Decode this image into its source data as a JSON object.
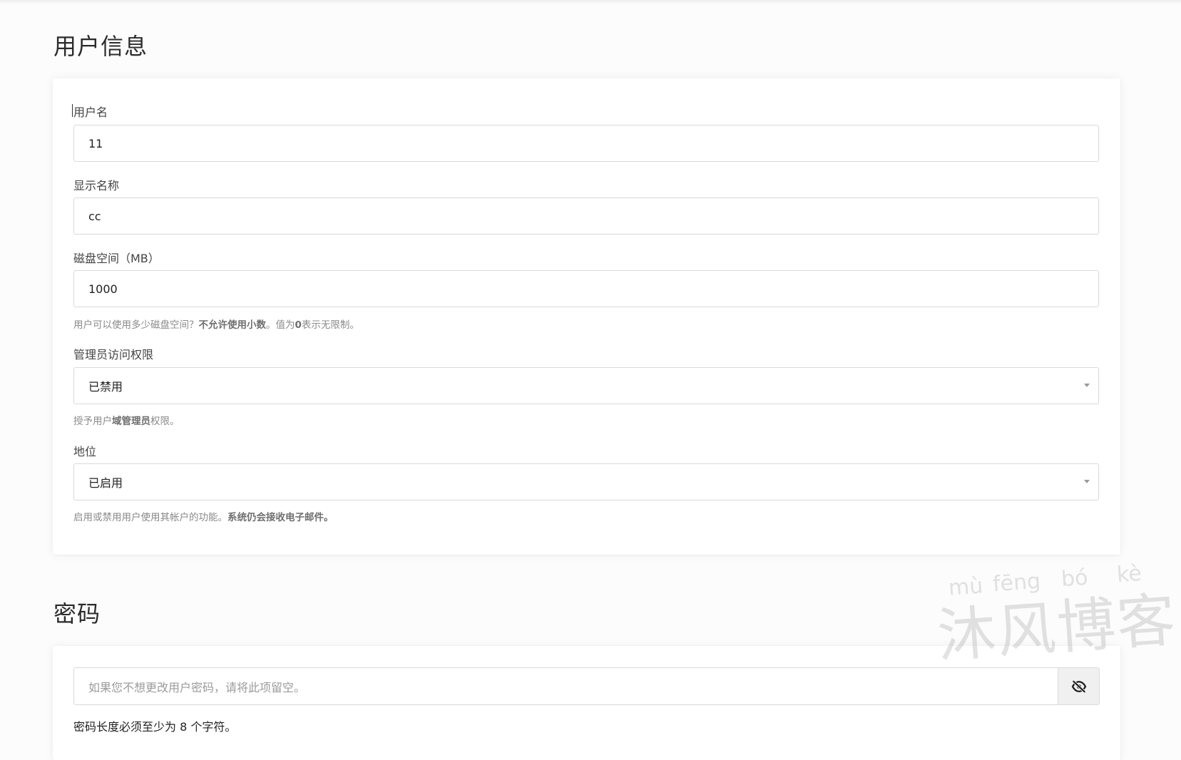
{
  "user_info": {
    "title": "用户信息",
    "fields": {
      "username": {
        "label": "用户名",
        "value": "11"
      },
      "display_name": {
        "label": "显示名称",
        "value": "cc"
      },
      "disk_space": {
        "label": "磁盘空间（MB）",
        "value": "1000",
        "help_pre": "用户可以使用多少磁盘空间？",
        "help_bold": "不允许使用小数",
        "help_mid": "。值为",
        "help_bold2": "0",
        "help_post": "表示无限制。"
      },
      "admin_access": {
        "label": "管理员访问权限",
        "value": "已禁用",
        "help_pre": "授予用户",
        "help_bold": "域管理员",
        "help_post": "权限。"
      },
      "status": {
        "label": "地位",
        "value": "已启用",
        "help_pre": "启用或禁用用户使用其帐户的功能。",
        "help_bold": "系统仍会接收电子邮件。"
      }
    }
  },
  "password": {
    "title": "密码",
    "placeholder": "如果您不想更改用户密码，请将此项留空。",
    "toggle_icon": "eye-slash-icon",
    "note": "密码长度必须至少为 8 个字符。"
  },
  "watermark": {
    "pinyin": [
      "mù",
      "fēng",
      "bó",
      "kè"
    ],
    "text": "沐风博客"
  }
}
